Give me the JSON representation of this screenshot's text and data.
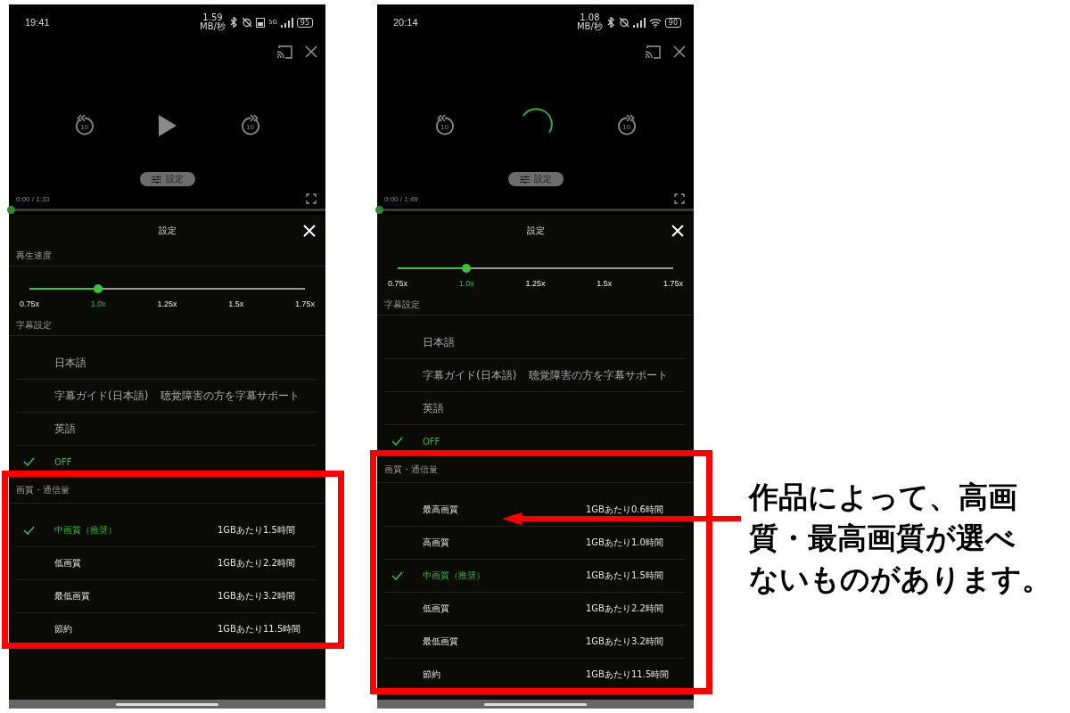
{
  "phones": [
    {
      "status_bar": {
        "time": "19:41",
        "net_speed": "1.59",
        "net_unit": "MB/秒",
        "storage_indicator": true,
        "network_label": "5G",
        "wifi": false,
        "battery": "95"
      },
      "player": {
        "kind": "paused",
        "rewind_seconds": "10",
        "forward_seconds": "10",
        "settings_button": "設定",
        "time": "0:00 / 1:33",
        "progress": {
          "level": 0
        }
      },
      "settings": {
        "title": "設定",
        "speed_header": "再生速度",
        "speed": {
          "level": 0.25,
          "options": [
            {
              "label": "0.75x",
              "selected": false
            },
            {
              "label": "1.0x",
              "selected": true
            },
            {
              "label": "1.25x",
              "selected": false
            },
            {
              "label": "1.5x",
              "selected": false
            },
            {
              "label": "1.75x",
              "selected": false
            }
          ]
        },
        "subtitles": {
          "header": "字幕設定",
          "options": [
            {
              "label": "日本語",
              "disabled": true,
              "selected": false
            },
            {
              "label": "字幕ガイド(日本語)",
              "note": "聴覚障害の方を字幕サポート",
              "disabled": true,
              "selected": false
            },
            {
              "label": "英語",
              "disabled": true,
              "selected": false
            },
            {
              "label": "OFF",
              "disabled": false,
              "selected": true
            }
          ]
        },
        "quality": {
          "header": "画質・通信量",
          "highlighted": true,
          "options": [
            {
              "label": "中画質（推奨）",
              "data": "1GBあたり1.5時間",
              "selected": true
            },
            {
              "label": "低画質",
              "data": "1GBあたり2.2時間",
              "selected": false
            },
            {
              "label": "最低画質",
              "data": "1GBあたり3.2時間",
              "selected": false
            },
            {
              "label": "節約",
              "data": "1GBあたり11.5時間",
              "selected": false
            }
          ]
        }
      }
    },
    {
      "status_bar": {
        "time": "20:14",
        "net_speed": "1.08",
        "net_unit": "MB/秒",
        "storage_indicator": false,
        "wifi": true,
        "battery": "90"
      },
      "player": {
        "kind": "loading",
        "rewind_seconds": "10",
        "forward_seconds": "10",
        "settings_button": "設定",
        "time": "0:00 / 1:49",
        "progress": {
          "level": 0
        }
      },
      "settings": {
        "title": "設定",
        "speed": {
          "level": 0.25,
          "options": [
            {
              "label": "0.75x",
              "selected": false
            },
            {
              "label": "1.0x",
              "selected": true
            },
            {
              "label": "1.25x",
              "selected": false
            },
            {
              "label": "1.5x",
              "selected": false
            },
            {
              "label": "1.75x",
              "selected": false
            }
          ]
        },
        "subtitles": {
          "header": "字幕設定",
          "options": [
            {
              "label": "日本語",
              "disabled": true,
              "selected": false
            },
            {
              "label": "字幕ガイド(日本語)",
              "note": "聴覚障害の方を字幕サポート",
              "disabled": true,
              "selected": false
            },
            {
              "label": "英語",
              "disabled": true,
              "selected": false
            },
            {
              "label": "OFF",
              "disabled": false,
              "selected": true
            }
          ]
        },
        "quality": {
          "header": "画質・通信量",
          "highlighted": true,
          "options": [
            {
              "label": "最高画質",
              "data": "1GBあたり0.6時間",
              "selected": false
            },
            {
              "label": "高画質",
              "data": "1GBあたり1.0時間",
              "selected": false
            },
            {
              "label": "中画質（推奨）",
              "data": "1GBあたり1.5時間",
              "selected": true
            },
            {
              "label": "低画質",
              "data": "1GBあたり2.2時間",
              "selected": false
            },
            {
              "label": "最低画質",
              "data": "1GBあたり3.2時間",
              "selected": false
            },
            {
              "label": "節約",
              "data": "1GBあたり11.5時間",
              "selected": false
            }
          ]
        }
      }
    }
  ],
  "annotation": {
    "lines": [
      "作品によって、高画",
      "質・最高画質が選べ",
      "ないものがあります。"
    ]
  }
}
